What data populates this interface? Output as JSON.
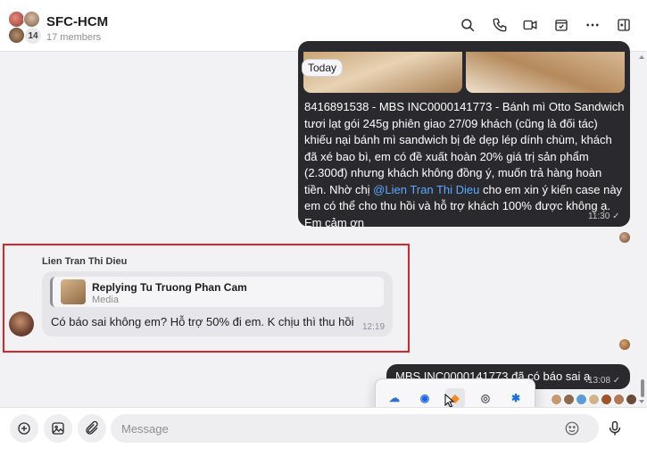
{
  "header": {
    "title": "SFC-HCM",
    "subtitle": "17 members",
    "avatar_count": "14",
    "icons": [
      "search-icon",
      "phone-icon",
      "video-call-icon",
      "task-icon",
      "more-icon",
      "side-panel-icon"
    ]
  },
  "messages": {
    "outgoing_main": {
      "date_chip": "Today",
      "text_part1": "8416891538 - MBS INC0000141773 - Bánh mì Otto Sandwich tươi lạt gói 245g phiên giao 27/09 khách (cũng là đối tác) khiếu nại bánh mì sandwich bị đè dẹp lép dính chùm, khách đã xé bao bì, em có đề xuất hoàn 20% giá trị sản phẩm (2.300đ) nhưng khách không đồng ý, muốn trả hàng hoàn tiền. Nhờ chị ",
      "mention": "@Lien Tran Thi Dieu",
      "text_part2": " cho em xin ý kiến case này em có thể cho thu hồi và hỗ trợ khách 100% được không ạ. Em cảm ơn",
      "time": "11:30"
    },
    "incoming": {
      "sender": "Lien Tran Thi Dieu",
      "reply_title": "Replying Tu Truong Phan Cam",
      "reply_sub": "Media",
      "text": "Có báo sai không em? Hỗ trợ 50% đi em. K chịu thì thu hồi",
      "time": "12:19"
    },
    "outgoing_last": {
      "text": "MBS INC0000141773 đã có báo sai ạ",
      "time": "13:08"
    }
  },
  "composer": {
    "placeholder": "Message"
  },
  "colors": {
    "outgoing_bubble": "#2a2a2e",
    "incoming_bubble": "#e5e5ea",
    "mention": "#5aa8ff",
    "highlight_border": "#d9262c"
  }
}
